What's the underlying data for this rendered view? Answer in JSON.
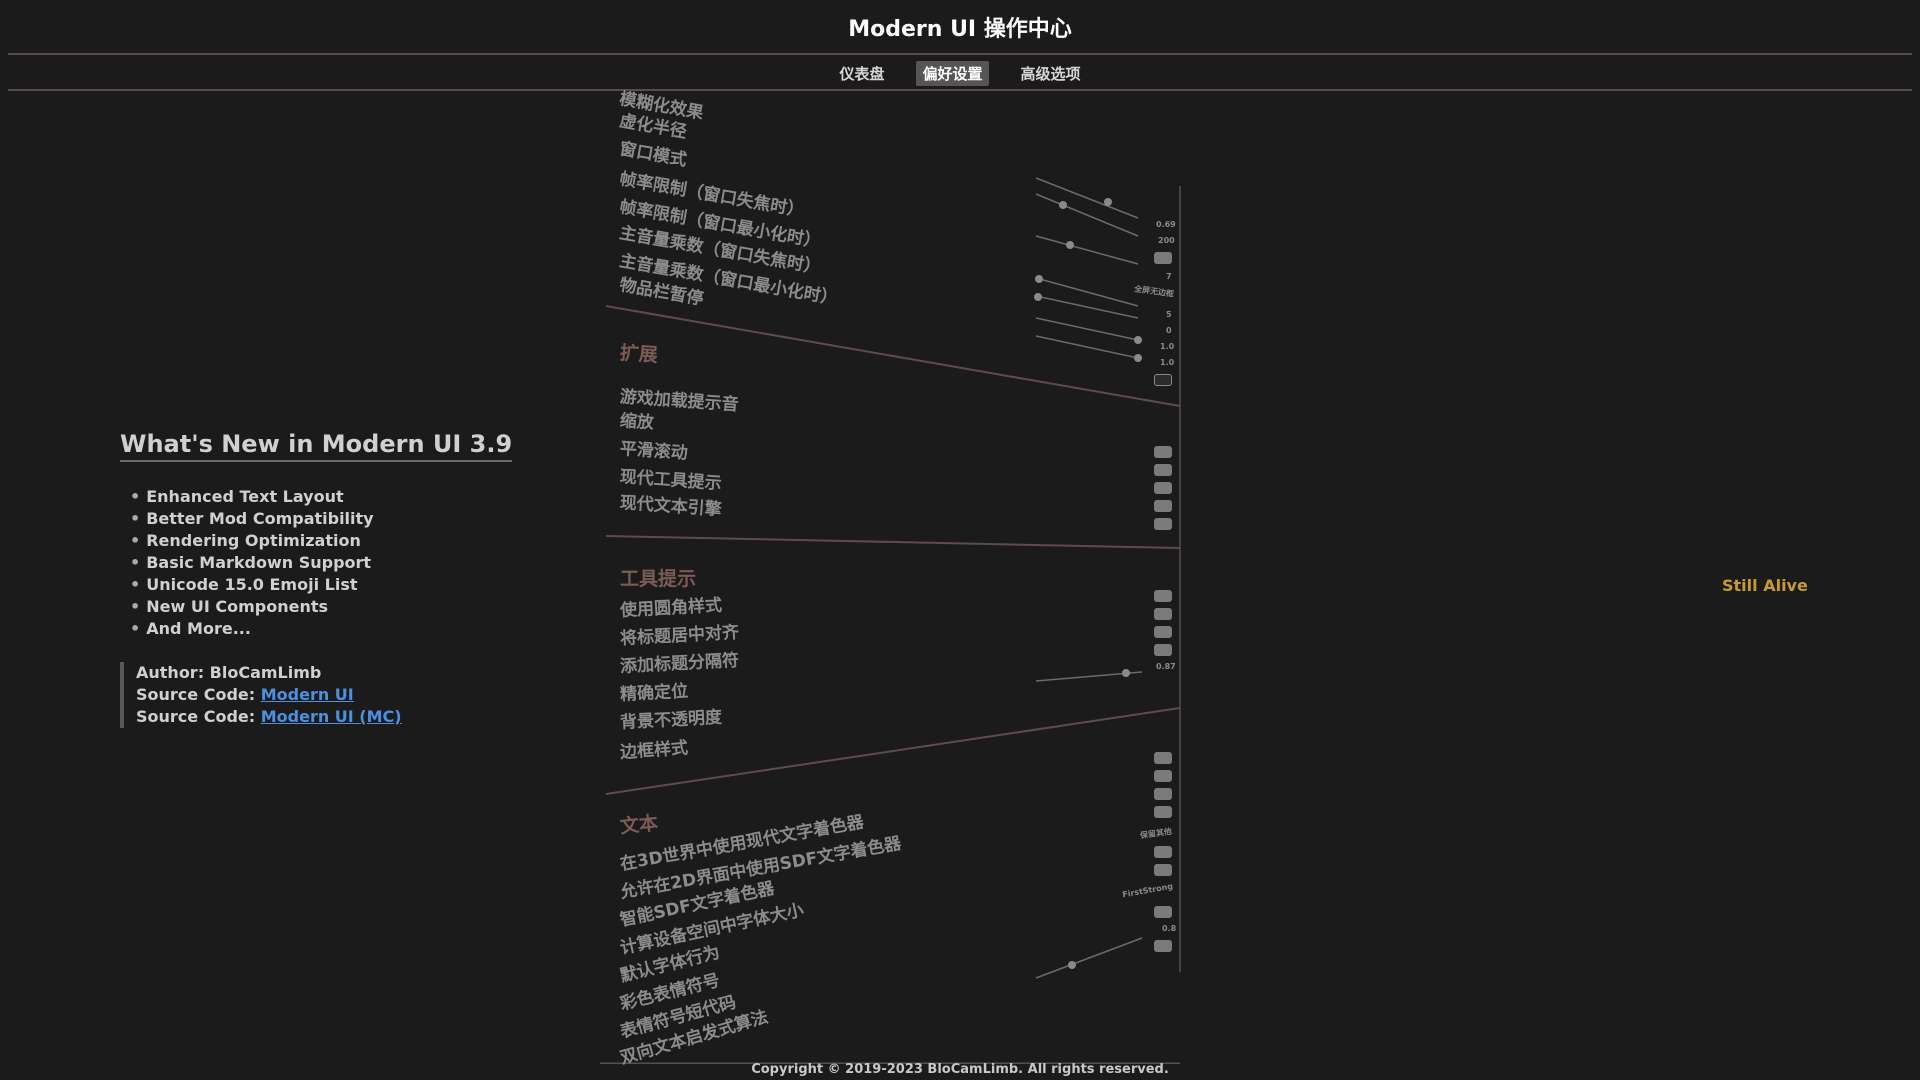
{
  "window": {
    "title": "Modern UI 操作中心"
  },
  "tabs": [
    {
      "label": "仪表盘"
    },
    {
      "label": "偏好设置",
      "active": true
    },
    {
      "label": "高级选项"
    }
  ],
  "info": {
    "title": "What's New in Modern UI 3.9",
    "features": [
      "Enhanced Text Layout",
      "Better Mod Compatibility",
      "Rendering Optimization",
      "Basic Markdown Support",
      "Unicode 15.0 Emoji List",
      "New UI Components",
      "And More..."
    ],
    "author_label": "Author:",
    "author": "BloCamLimb",
    "source_label": "Source Code:",
    "source_link_1": "Modern UI",
    "source_link_2": "Modern UI (MC)",
    "bullet": "•"
  },
  "settings": {
    "group1": {
      "items": [
        "模糊化效果",
        "虚化半径",
        "窗口模式",
        "帧率限制（窗口失焦时）",
        "帧率限制（窗口最小化时）",
        "主音量乘数（窗口失焦时）",
        "主音量乘数（窗口最小化时）",
        "物品栏暂停"
      ],
      "values": [
        "0.69",
        "200",
        "7",
        "全屏无边框",
        "5",
        "0",
        "1.0",
        "1.0"
      ]
    },
    "group2": {
      "heading": "扩展",
      "items": [
        "游戏加载提示音",
        "缩放",
        "平滑滚动",
        "现代工具提示",
        "现代文本引擎"
      ]
    },
    "group3": {
      "heading": "工具提示",
      "items": [
        "使用圆角样式",
        "将标题居中对齐",
        "添加标题分隔符",
        "精确定位",
        "背景不透明度",
        "边框样式"
      ],
      "values": [
        "0.87"
      ]
    },
    "group4": {
      "heading": "文本",
      "items": [
        "在3D世界中使用现代文字着色器",
        "允许在2D界面中使用SDF文字着色器",
        "智能SDF文字着色器",
        "计算设备空间中字体大小",
        "默认字体行为",
        "彩色表情符号",
        "表情符号短代码",
        "双向文本启发式算法"
      ],
      "values": [
        "保留其他",
        "FirstStrong",
        "0.8"
      ]
    }
  },
  "status": {
    "still_alive": "Still Alive"
  },
  "footer": {
    "copyright": "Copyright © 2019-2023 BloCamLimb. All rights reserved."
  }
}
